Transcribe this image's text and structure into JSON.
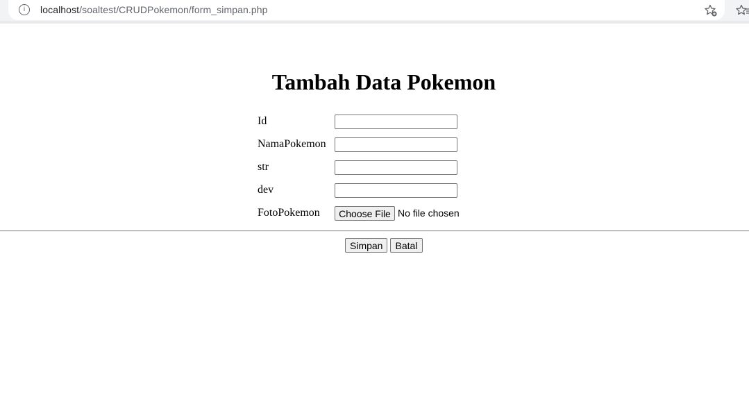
{
  "browser": {
    "url_host": "localhost",
    "url_path": "/soaltest/CRUDPokemon/form_simpan.php",
    "info_icon": "info-icon",
    "bookmark_icon": "star-add-icon",
    "reading_list_icon": "reading-list-icon"
  },
  "page": {
    "title": "Tambah Data Pokemon"
  },
  "form": {
    "fields": [
      {
        "label": "Id",
        "value": ""
      },
      {
        "label": "NamaPokemon",
        "value": ""
      },
      {
        "label": "str",
        "value": ""
      },
      {
        "label": "dev",
        "value": ""
      }
    ],
    "file_field": {
      "label": "FotoPokemon",
      "button_label": "Choose File",
      "status": "No file chosen"
    },
    "submit_label": "Simpan",
    "cancel_label": "Batal"
  }
}
